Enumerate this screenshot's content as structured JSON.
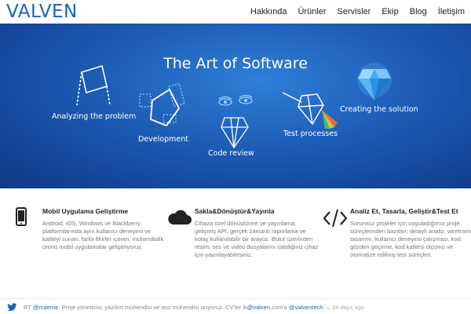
{
  "brand": {
    "logo_text": "VALVEN",
    "accent_color": "#1c64ba"
  },
  "nav": {
    "items": [
      {
        "label": "Hakkında"
      },
      {
        "label": "Ürünler"
      },
      {
        "label": "Servisler"
      },
      {
        "label": "Ekip"
      },
      {
        "label": "Blog"
      },
      {
        "label": "İletişim"
      }
    ]
  },
  "hero": {
    "title": "The Art of Software",
    "steps": [
      {
        "label": "Analyzing the problem"
      },
      {
        "label": "Development"
      },
      {
        "label": "Code review"
      },
      {
        "label": "Test processes"
      },
      {
        "label": "Creating the solution"
      }
    ]
  },
  "features": [
    {
      "icon": "smartphone-icon",
      "title": "Mobil Uygulama Geliştirme",
      "description": "Android, iOS, Windows ve Blackberry platformlarında aynı kullanıcı deneyimi ve kaliteyi sunan, farklı fikirler içeren, mühendislik ürünü mobil uygulamalar geliştiriyoruz."
    },
    {
      "icon": "cloud-icon",
      "title": "Sakla&Dönüştür&Yayınla",
      "description": "Cihaza özel dönüştürme ve yayınlama, gelişmiş API, gerçek zamanlı raporlama ve kolay kullanılabilir bir arayüz. Bulut üzerinden resim, ses ve video dosyalarını istediğiniz cihaz için yayınlayabilirsiniz."
    },
    {
      "icon": "code-icon",
      "title": "Analiz Et, Tasarla, Geliştir&Test Et",
      "description": "Sorunsuz projeler için uyguladığımız proje süreçlerinden bazıları; detaylı analiz, wireframe tasarımı, kullanıcı deneyimi çalışması, kod gözden geçirme, kod kalitesi ölçümü ve otomatize edilmiş test süreçleri."
    }
  ],
  "tweet": {
    "prefix": "RT ",
    "mention": "@mdemir",
    "body": ": Proje yöneticisi, yazılım mühendisi ve test mühendisi arıyoruz. CV'ler ik",
    "email_link": "@valven",
    "email_suffix": ".com'a ",
    "handle": "@valventech",
    "ago": "— 24 days ago"
  }
}
